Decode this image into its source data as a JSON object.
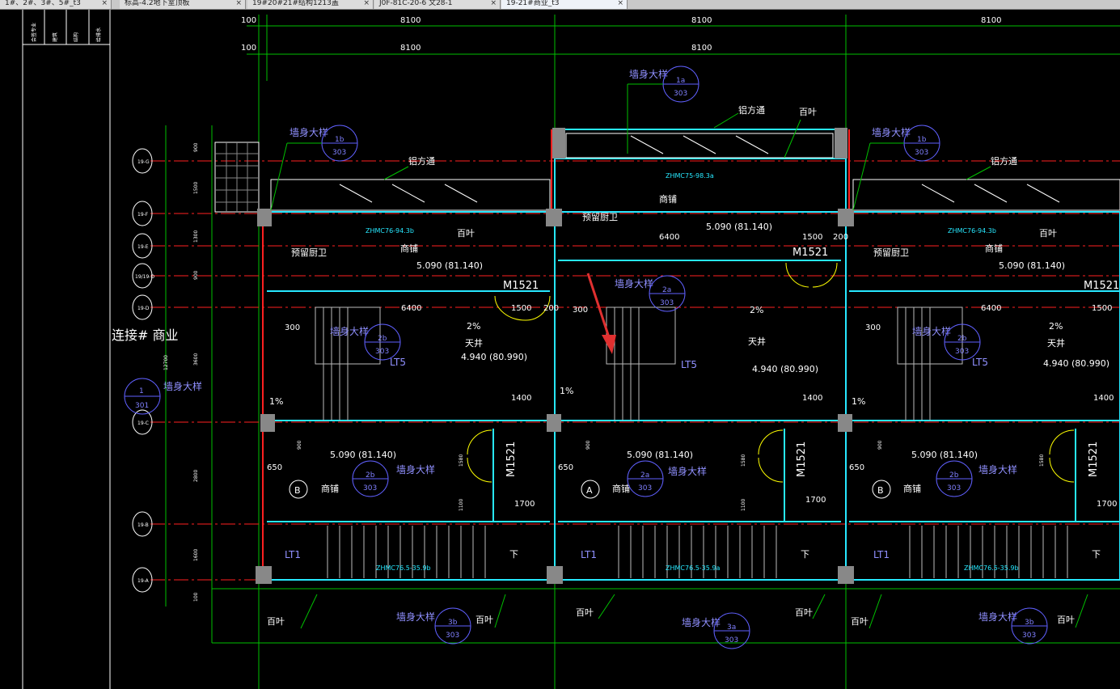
{
  "tabs": [
    {
      "label": "1#、2#、3#、5#_t3"
    },
    {
      "label": "标高-4.2地下室顶板"
    },
    {
      "label": "19#20#21#结构1213盖"
    },
    {
      "label": "J0F-81C-20-6 文28-1"
    },
    {
      "label": "19-21#商业_t3"
    }
  ],
  "side_panel": {
    "col1": "会签专业",
    "col2": "建筑",
    "col3": "结构",
    "col4": "给排水"
  },
  "dims_top": {
    "row1_left": "100",
    "row1_mid": "8100",
    "row1_right": "8100",
    "row1_far": "8100",
    "row2_left": "100",
    "row2_mid": "8100",
    "row2_right": "8100"
  },
  "dims_left": [
    "900",
    "1500",
    "1300",
    "900",
    "3600",
    "12700",
    "2800",
    "1600",
    "100"
  ],
  "axes": [
    "19-G",
    "19-F",
    "19-E",
    "19/19-D",
    "19-D",
    "19-C",
    "19-B",
    "19-A"
  ],
  "labels": {
    "wall_detail": "墙身大样",
    "alu": "铝方通",
    "louver": "百叶",
    "kitchen": "预留厨卫",
    "shop": "商铺",
    "courtyard": "天井",
    "link": "连接# 商业",
    "down": "下",
    "m1521": "M1521",
    "lt5": "LT5",
    "lt1": "LT1",
    "slope": "2%",
    "slope1": "1%",
    "unit_a": "A",
    "unit_b": "B"
  },
  "elev": {
    "e1": "5.090  (81.140)",
    "e2": "4.940  (80.990)"
  },
  "dims_inner": {
    "d6400": "6400",
    "d1500": "1500",
    "d200": "200",
    "d300": "300",
    "d1400": "1400",
    "d900": "900",
    "d650": "650",
    "d1700": "1700",
    "d1100": "1100",
    "d1580": "1580"
  },
  "win_codes": {
    "w1": "ZHMC76-94.3b",
    "w2": "ZHMC75-98.3a",
    "w3": "ZHMC76.5-35.9b",
    "w4": "ZHMC76.5-35.9a"
  },
  "bubbles": {
    "b1a": "1a",
    "b1b": "1b",
    "b2a": "2a",
    "b2b": "2b",
    "b3a": "3a",
    "b3b": "3b",
    "b1": "1",
    "ref": "303",
    "ref1": "301"
  },
  "colors": {
    "bg": "#000000",
    "grid": "#00c000",
    "axis_red": "#ff2020",
    "wall": "#27e8ff",
    "text_blue": "#8080ff",
    "door": "#ffff00",
    "annot_arrow": "#e03030"
  }
}
